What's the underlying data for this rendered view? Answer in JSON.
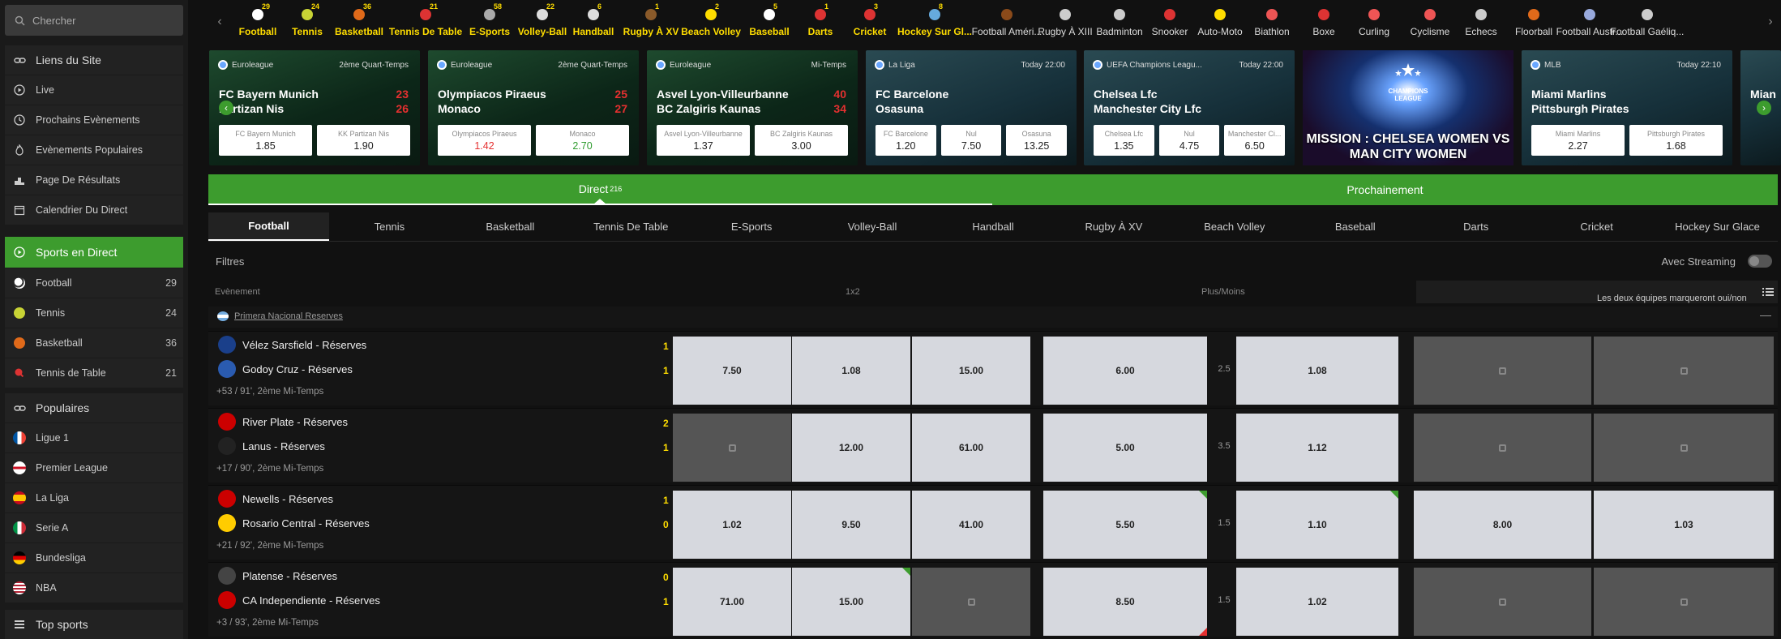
{
  "search": {
    "placeholder": "Chercher"
  },
  "sidebar": {
    "links_title": "Liens du Site",
    "links": [
      {
        "label": "Live",
        "icon": "play-circle-icon"
      },
      {
        "label": "Prochains Evènements",
        "icon": "clock-icon"
      },
      {
        "label": "Evènements Populaires",
        "icon": "fire-icon"
      },
      {
        "label": "Page De Résultats",
        "icon": "podium-icon"
      },
      {
        "label": "Calendrier Du Direct",
        "icon": "calendar-icon"
      }
    ],
    "live_title": "Sports en Direct",
    "live_sports": [
      {
        "label": "Football",
        "count": "29"
      },
      {
        "label": "Tennis",
        "count": "24"
      },
      {
        "label": "Basketball",
        "count": "36"
      },
      {
        "label": "Tennis de Table",
        "count": "21"
      }
    ],
    "popular_title": "Populaires",
    "popular": [
      {
        "label": "Ligue 1"
      },
      {
        "label": "Premier League"
      },
      {
        "label": "La Liga"
      },
      {
        "label": "Serie A"
      },
      {
        "label": "Bundesliga"
      },
      {
        "label": "NBA"
      }
    ],
    "top_title": "Top sports"
  },
  "topbar": {
    "sports": [
      {
        "label": "Football",
        "count": "29"
      },
      {
        "label": "Tennis",
        "count": "24"
      },
      {
        "label": "Basketball",
        "count": "36"
      },
      {
        "label": "Tennis De Table",
        "count": "21"
      },
      {
        "label": "E-Sports",
        "count": "58"
      },
      {
        "label": "Volley-Ball",
        "count": "22"
      },
      {
        "label": "Handball",
        "count": "6"
      },
      {
        "label": "Rugby À XV",
        "count": "1"
      },
      {
        "label": "Beach Volley",
        "count": "2"
      },
      {
        "label": "Baseball",
        "count": "5"
      },
      {
        "label": "Darts",
        "count": "1"
      },
      {
        "label": "Cricket",
        "count": "3"
      },
      {
        "label": "Hockey Sur Gl...",
        "count": "8"
      },
      {
        "label": "Football Améri...",
        "count": ""
      },
      {
        "label": "Rugby À XIII",
        "count": ""
      },
      {
        "label": "Badminton",
        "count": ""
      },
      {
        "label": "Snooker",
        "count": ""
      },
      {
        "label": "Auto-Moto",
        "count": ""
      },
      {
        "label": "Biathlon",
        "count": ""
      },
      {
        "label": "Boxe",
        "count": ""
      },
      {
        "label": "Curling",
        "count": ""
      },
      {
        "label": "Cyclisme",
        "count": ""
      },
      {
        "label": "Echecs",
        "count": ""
      },
      {
        "label": "Floorball",
        "count": ""
      },
      {
        "label": "Football Austr...",
        "count": ""
      },
      {
        "label": "Football Gaéliq...",
        "count": ""
      }
    ]
  },
  "carousel": {
    "cards": [
      {
        "league": "Euroleague",
        "when": "2ème Quart-Temps",
        "team1": "FC Bayern Munich",
        "team2": "Partizan Nis",
        "score1": "23",
        "score2": "26",
        "odds": [
          {
            "label": "FC Bayern Munich",
            "value": "1.85"
          },
          {
            "label": "KK Partizan Nis",
            "value": "1.90"
          }
        ]
      },
      {
        "league": "Euroleague",
        "when": "2ème Quart-Temps",
        "team1": "Olympiacos Piraeus",
        "team2": "Monaco",
        "score1": "25",
        "score2": "27",
        "odds": [
          {
            "label": "Olympiacos Piraeus",
            "value": "1.42"
          },
          {
            "label": "Monaco",
            "value": "2.70"
          }
        ]
      },
      {
        "league": "Euroleague",
        "when": "Mi-Temps",
        "team1": "Asvel Lyon-Villeurbanne",
        "team2": "BC Zalgiris Kaunas",
        "score1": "40",
        "score2": "34",
        "odds": [
          {
            "label": "Asvel Lyon-Villeurbanne",
            "value": "1.37"
          },
          {
            "label": "BC Zalgiris Kaunas",
            "value": "3.00"
          }
        ]
      },
      {
        "league": "La Liga",
        "when": "Today 22:00",
        "team1": "FC Barcelone",
        "team2": "Osasuna",
        "score1": "",
        "score2": "",
        "odds": [
          {
            "label": "FC Barcelone",
            "value": "1.20"
          },
          {
            "label": "Nul",
            "value": "7.50"
          },
          {
            "label": "Osasuna",
            "value": "13.25"
          }
        ]
      },
      {
        "league": "UEFA Champions Leagu...",
        "when": "Today 22:00",
        "team1": "Chelsea Lfc",
        "team2": "Manchester City Lfc",
        "score1": "",
        "score2": "",
        "odds": [
          {
            "label": "Chelsea Lfc",
            "value": "1.35"
          },
          {
            "label": "Nul",
            "value": "4.75"
          },
          {
            "label": "Manchester Ci...",
            "value": "6.50"
          }
        ]
      },
      {
        "league": "MLB",
        "when": "Today 22:10",
        "team1": "Miami Marlins",
        "team2": "Pittsburgh Pirates",
        "score1": "",
        "score2": "",
        "odds": [
          {
            "label": "Miami Marlins",
            "value": "2.27"
          },
          {
            "label": "Pittsburgh Pirates",
            "value": "1.68"
          }
        ]
      }
    ],
    "promo_text": "MISSION : CHELSEA WOMEN VS MAN CITY WOMEN",
    "promo_logo": "CHAMPIONS LEAGUE",
    "partial": "Mian"
  },
  "tabs": {
    "direct": "Direct",
    "direct_count": "216",
    "next": "Prochainement"
  },
  "sport_tabs": [
    "Football",
    "Tennis",
    "Basketball",
    "Tennis De Table",
    "E-Sports",
    "Volley-Ball",
    "Handball",
    "Rugby À XV",
    "Beach Volley",
    "Baseball",
    "Darts",
    "Cricket",
    "Hockey Sur Glace"
  ],
  "filters": {
    "label": "Filtres",
    "streaming": "Avec Streaming"
  },
  "columns": {
    "event": "Evènement",
    "x12": "1x2",
    "ou": "Plus/Moins",
    "btts": "Les deux équipes marqueront oui/non"
  },
  "competition": "Primera Nacional Reserves",
  "matches": [
    {
      "team1": "Vélez Sarsfield - Réserves",
      "team2": "Godoy Cruz - Réserves",
      "score1": "1",
      "score2": "1",
      "info": "+53 / 91', 2ème Mi-Temps",
      "odds": [
        "7.50",
        "1.08",
        "15.00",
        "6.00",
        "2.5",
        "1.08",
        "",
        ""
      ]
    },
    {
      "team1": "River Plate - Réserves",
      "team2": "Lanus - Réserves",
      "score1": "2",
      "score2": "1",
      "info": "+17 / 90', 2ème Mi-Temps",
      "odds": [
        "",
        "12.00",
        "61.00",
        "5.00",
        "3.5",
        "1.12",
        "",
        ""
      ]
    },
    {
      "team1": "Newells - Réserves",
      "team2": "Rosario Central - Réserves",
      "score1": "1",
      "score2": "0",
      "info": "+21 / 92', 2ème Mi-Temps",
      "odds": [
        "1.02",
        "9.50",
        "41.00",
        "5.50",
        "1.5",
        "1.10",
        "8.00",
        "1.03"
      ]
    },
    {
      "team1": "Platense - Réserves",
      "team2": "CA Independiente - Réserves",
      "score1": "0",
      "score2": "1",
      "info": "+3 / 93', 2ème Mi-Temps",
      "odds": [
        "71.00",
        "15.00",
        "",
        "8.50",
        "1.5",
        "1.02",
        "",
        ""
      ]
    }
  ],
  "colors": {
    "accent": "#3d9c2e",
    "live_yellow": "#ffdd00",
    "score_red": "#e53030"
  }
}
